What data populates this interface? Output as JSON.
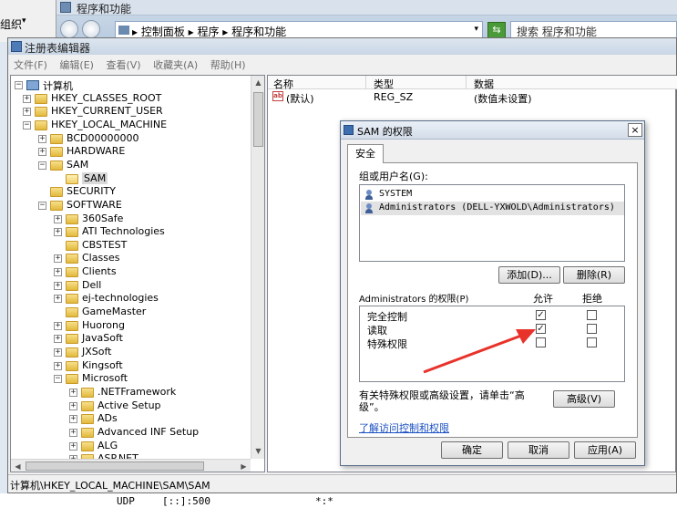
{
  "background_window": {
    "title": "程序和功能",
    "organize_label": "组织",
    "address_path": "▸ 控制面板 ▸ 程序 ▸ 程序和功能",
    "search_placeholder": "搜索 程序和功能"
  },
  "regedit": {
    "title": "注册表编辑器",
    "menu": [
      "文件(F)",
      "编辑(E)",
      "查看(V)",
      "收藏夹(A)",
      "帮助(H)"
    ],
    "tree": [
      {
        "label": "计算机",
        "expander": "−",
        "icon": "computer-icon",
        "level": 0
      },
      {
        "label": "HKEY_CLASSES_ROOT",
        "expander": "+",
        "level": 1
      },
      {
        "label": "HKEY_CURRENT_USER",
        "expander": "+",
        "level": 1
      },
      {
        "label": "HKEY_LOCAL_MACHINE",
        "expander": "−",
        "level": 1
      },
      {
        "label": "BCD00000000",
        "expander": "+",
        "level": 2
      },
      {
        "label": "HARDWARE",
        "expander": "+",
        "level": 2
      },
      {
        "label": "SAM",
        "expander": "−",
        "level": 2
      },
      {
        "label": "SAM",
        "expander": "",
        "level": 3,
        "selected": true
      },
      {
        "label": "SECURITY",
        "expander": "",
        "level": 2
      },
      {
        "label": "SOFTWARE",
        "expander": "−",
        "level": 2
      },
      {
        "label": "360Safe",
        "expander": "+",
        "level": 3
      },
      {
        "label": "ATI Technologies",
        "expander": "+",
        "level": 3
      },
      {
        "label": "CBSTEST",
        "expander": "",
        "level": 3
      },
      {
        "label": "Classes",
        "expander": "+",
        "level": 3
      },
      {
        "label": "Clients",
        "expander": "+",
        "level": 3
      },
      {
        "label": "Dell",
        "expander": "+",
        "level": 3
      },
      {
        "label": "ej-technologies",
        "expander": "+",
        "level": 3
      },
      {
        "label": "GameMaster",
        "expander": "",
        "level": 3
      },
      {
        "label": "Huorong",
        "expander": "+",
        "level": 3
      },
      {
        "label": "JavaSoft",
        "expander": "+",
        "level": 3
      },
      {
        "label": "JXSoft",
        "expander": "+",
        "level": 3
      },
      {
        "label": "Kingsoft",
        "expander": "+",
        "level": 3
      },
      {
        "label": "Microsoft",
        "expander": "−",
        "level": 3
      },
      {
        "label": ".NETFramework",
        "expander": "+",
        "level": 4
      },
      {
        "label": "Active Setup",
        "expander": "+",
        "level": 4
      },
      {
        "label": "ADs",
        "expander": "+",
        "level": 4
      },
      {
        "label": "Advanced INF Setup",
        "expander": "+",
        "level": 4
      },
      {
        "label": "ALG",
        "expander": "+",
        "level": 4
      },
      {
        "label": "ASP.NET",
        "expander": "+",
        "level": 4
      }
    ],
    "list_headers": {
      "name": "名称",
      "type": "类型",
      "data": "数据"
    },
    "list_rows": [
      {
        "name": "(默认)",
        "type": "REG_SZ",
        "data": "(数值未设置)"
      }
    ],
    "status_path": "计算机\\HKEY_LOCAL_MACHINE\\SAM\\SAM"
  },
  "dialog": {
    "title": "SAM 的权限",
    "close_label": "×",
    "tab_label": "安全",
    "group_label": "组或用户名(G):",
    "users": [
      {
        "name": "SYSTEM",
        "selected": false
      },
      {
        "name": "Administrators (DELL-YXWOLD\\Administrators)",
        "selected": true
      }
    ],
    "add_label": "添加(D)...",
    "remove_label": "删除(R)",
    "perm_label": "Administrators 的权限(P)",
    "allow_header": "允许",
    "deny_header": "拒绝",
    "permissions": [
      {
        "name": "完全控制",
        "allow": true,
        "deny": false
      },
      {
        "name": "读取",
        "allow": true,
        "deny": false
      },
      {
        "name": "特殊权限",
        "allow": false,
        "deny": false
      }
    ],
    "special_text": "有关特殊权限或高级设置，请单击“高级”。",
    "advanced_label": "高级(V)",
    "learn_link": "了解访问控制和权限",
    "ok_label": "确定",
    "cancel_label": "取消",
    "apply_label": "应用(A)"
  },
  "bottom_strip": {
    "col1": "UDP",
    "col2": "[::]:500",
    "col3": "*:*"
  },
  "colors": {
    "annotation_arrow": "#e8322a",
    "link": "#1a4fc2",
    "title_bar": "#d3dde9"
  }
}
